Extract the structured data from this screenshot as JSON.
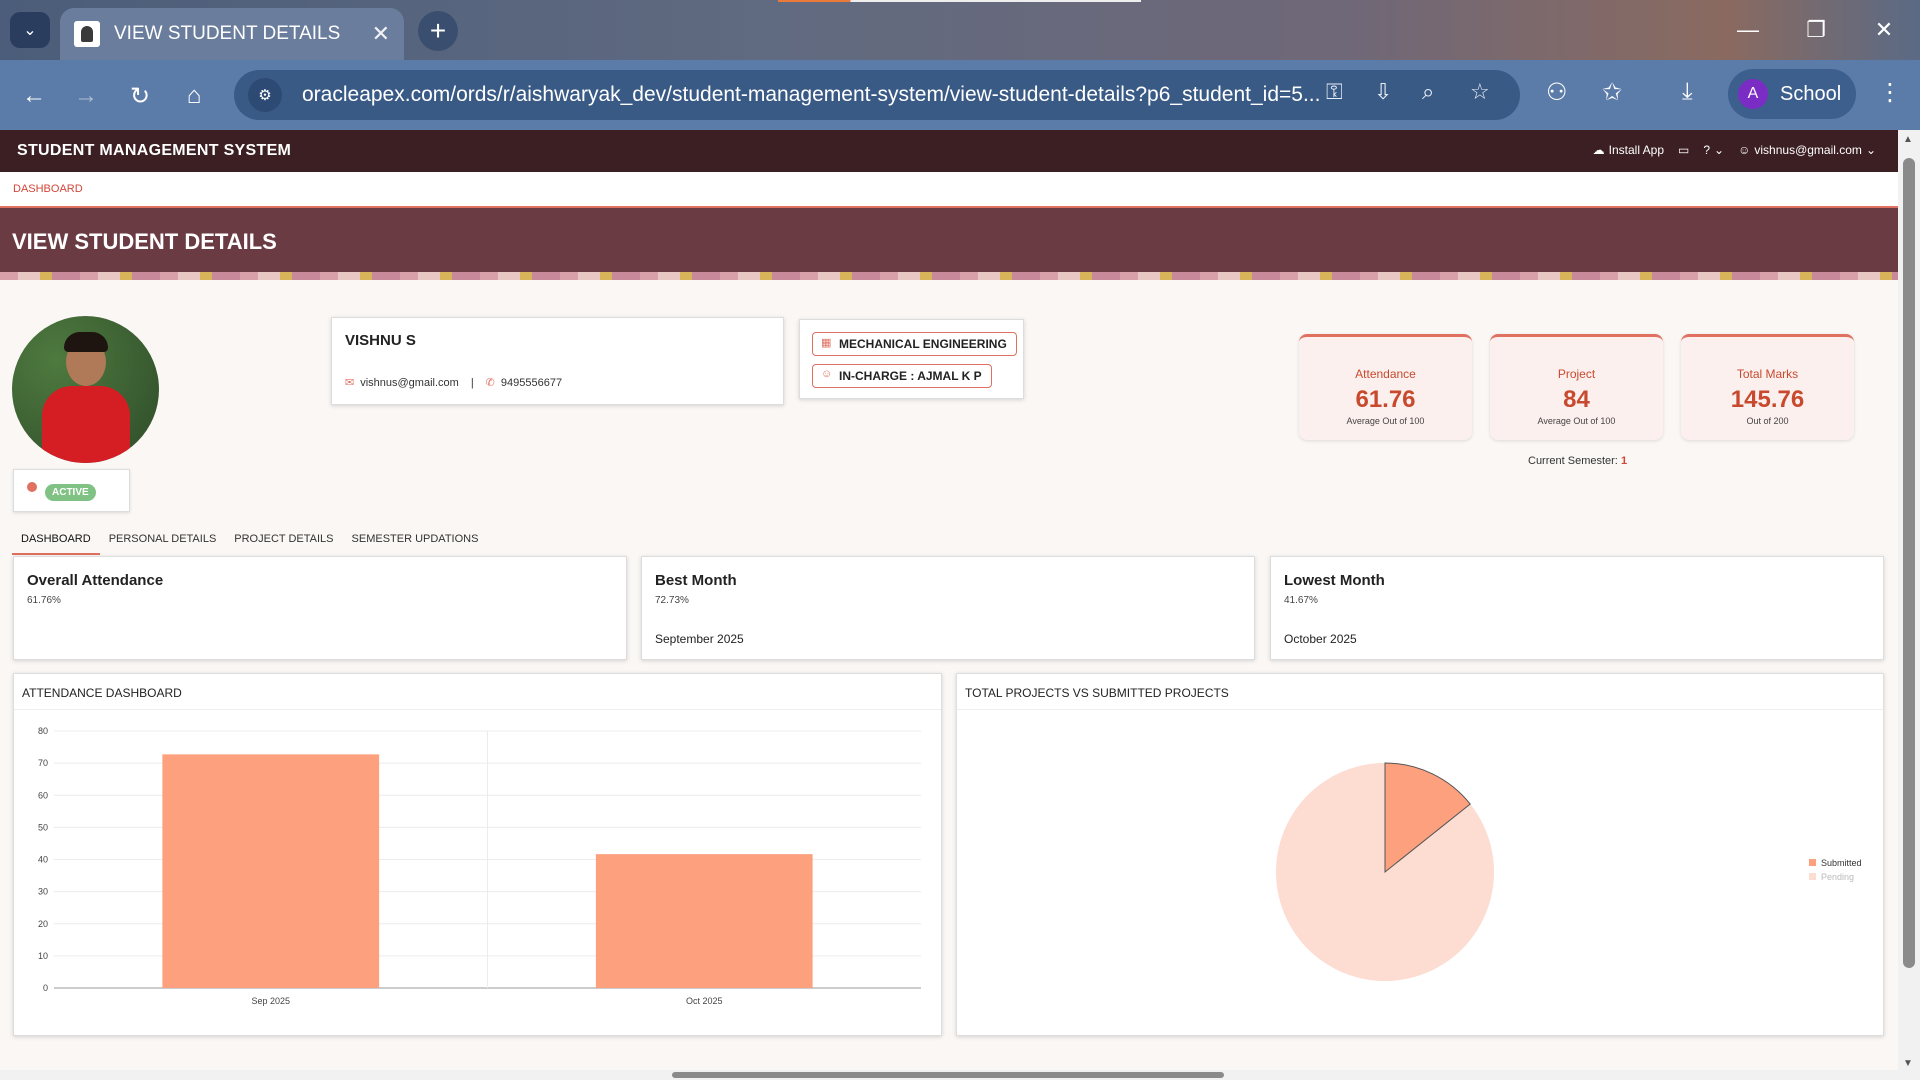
{
  "browser": {
    "tab_title": "VIEW STUDENT DETAILS",
    "url": "oracleapex.com/ords/r/aishwaryak_dev/student-management-system/view-student-details?p6_student_id=5...",
    "profile_initial": "A",
    "profile_name": "School"
  },
  "app": {
    "title": "STUDENT MANAGEMENT SYSTEM",
    "install_label": "Install App",
    "user_email": "vishnus@gmail.com",
    "breadcrumb": "DASHBOARD",
    "page_title": "VIEW STUDENT DETAILS"
  },
  "student": {
    "name": "VISHNU S",
    "email": "vishnus@gmail.com",
    "separator": "|",
    "phone": "9495556677",
    "status": "ACTIVE",
    "department": "MECHANICAL ENGINEERING",
    "incharge": "IN-CHARGE : AJMAL K P"
  },
  "stats": [
    {
      "label": "Attendance",
      "value": "61.76",
      "sub": "Average Out of 100"
    },
    {
      "label": "Project",
      "value": "84",
      "sub": "Average Out of 100"
    },
    {
      "label": "Total Marks",
      "value": "145.76",
      "sub": "Out of 200"
    }
  ],
  "semester": {
    "label": "Current Semester:",
    "value": "1"
  },
  "tabs": [
    "DASHBOARD",
    "PERSONAL DETAILS",
    "PROJECT DETAILS",
    "SEMESTER UPDATIONS"
  ],
  "kpis": [
    {
      "title": "Overall Attendance",
      "pct": "61.76%",
      "month": ""
    },
    {
      "title": "Best Month",
      "pct": "72.73%",
      "month": "September 2025"
    },
    {
      "title": "Lowest Month",
      "pct": "41.67%",
      "month": "October 2025"
    }
  ],
  "panels": {
    "attendance_title": "ATTENDANCE DASHBOARD",
    "projects_title": "TOTAL PROJECTS VS SUBMITTED PROJECTS"
  },
  "colors": {
    "accent": "#e07060",
    "bar": "#fca07e",
    "pie_pending": "#fddcd2",
    "pie_submitted": "#fca07e",
    "header": "#3b1f23"
  },
  "chart_data": [
    {
      "type": "bar",
      "categories": [
        "Sep 2025",
        "Oct 2025"
      ],
      "values": [
        72.73,
        41.67
      ],
      "ylim": [
        0,
        80
      ],
      "yticks": [
        0,
        10,
        20,
        30,
        40,
        50,
        60,
        70,
        80
      ],
      "grid": true
    },
    {
      "type": "pie",
      "labels": [
        "Submitted",
        "Pending"
      ],
      "values": [
        1,
        6
      ],
      "legend": "right"
    }
  ]
}
